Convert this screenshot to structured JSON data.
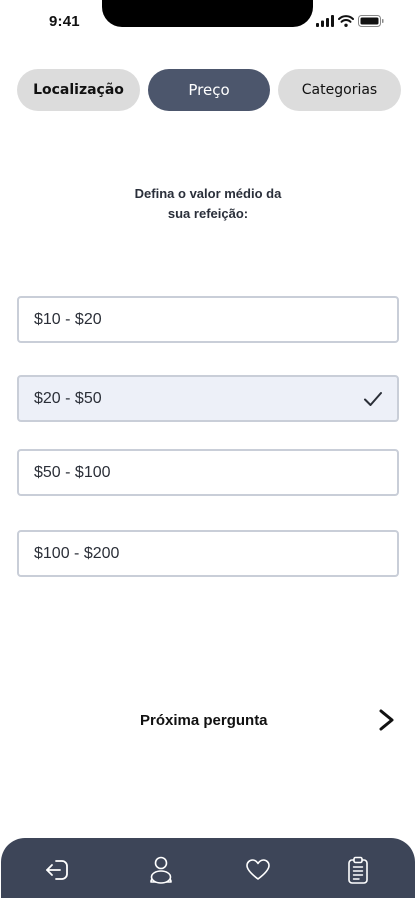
{
  "status_bar": {
    "time": "9:41"
  },
  "tabs": [
    {
      "label": "Localização",
      "state": "inactive"
    },
    {
      "label": "Preço",
      "state": "active"
    },
    {
      "label": "Categorias",
      "state": "inactive"
    }
  ],
  "question": {
    "line1": "Defina o valor médio da",
    "line2": "sua refeição:"
  },
  "options": [
    {
      "label": "$10 - $20",
      "selected": false
    },
    {
      "label": "$20 - $50",
      "selected": true
    },
    {
      "label": "$50 - $100",
      "selected": false
    },
    {
      "label": "$100 - $200",
      "selected": false
    }
  ],
  "next": {
    "label": "Próxima pergunta",
    "icon": "chevron-right-icon"
  },
  "bottom_nav": [
    {
      "icon": "login-icon"
    },
    {
      "icon": "user-icon"
    },
    {
      "icon": "heart-icon"
    },
    {
      "icon": "clipboard-icon"
    }
  ],
  "colors": {
    "active_tab": "#4c566c",
    "inactive_tab": "#dcdcdc",
    "nav_bar": "#3d4558",
    "selected_option_bg": "#edf0f8",
    "option_border": "#c9ced8"
  }
}
